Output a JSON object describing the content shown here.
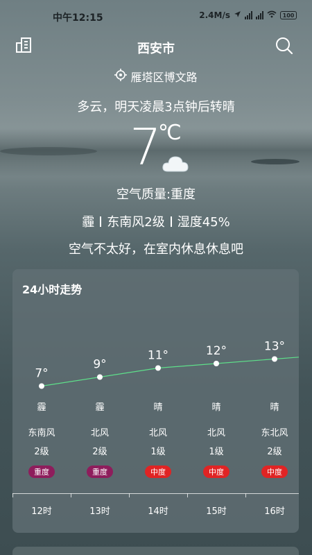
{
  "status_bar": {
    "time": "中午12:15",
    "speed": "2.4M/s",
    "battery": "100"
  },
  "header": {
    "city": "西安市",
    "location": "雁塔区博文路",
    "description": "多云，明天凌晨3点钟后转晴"
  },
  "current": {
    "temperature": "7",
    "unit": "℃",
    "weather_icon": "cloud-icon",
    "air_quality": "空气质量:重度",
    "condition": "霾",
    "wind": "东南风2级",
    "humidity": "湿度45%",
    "advice": "空气不太好，在室内休息休息吧"
  },
  "forecast": {
    "title": "24小时走势",
    "hours": [
      {
        "temp_label": "7°",
        "temp": 7,
        "condition": "霾",
        "wind_dir": "东南风",
        "wind_level": "2级",
        "aqi": "重度",
        "aqi_color": "#8e1d5c",
        "time": "12时"
      },
      {
        "temp_label": "9°",
        "temp": 9,
        "condition": "霾",
        "wind_dir": "北风",
        "wind_level": "2级",
        "aqi": "重度",
        "aqi_color": "#8e1d5c",
        "time": "13时"
      },
      {
        "temp_label": "11°",
        "temp": 11,
        "condition": "晴",
        "wind_dir": "北风",
        "wind_level": "1级",
        "aqi": "中度",
        "aqi_color": "#e02424",
        "time": "14时"
      },
      {
        "temp_label": "12°",
        "temp": 12,
        "condition": "晴",
        "wind_dir": "北风",
        "wind_level": "1级",
        "aqi": "中度",
        "aqi_color": "#e02424",
        "time": "15时"
      },
      {
        "temp_label": "13°",
        "temp": 13,
        "condition": "晴",
        "wind_dir": "东北风",
        "wind_level": "2级",
        "aqi": "中度",
        "aqi_color": "#e02424",
        "time": "16时"
      }
    ],
    "line_color": "#5ee08a"
  }
}
